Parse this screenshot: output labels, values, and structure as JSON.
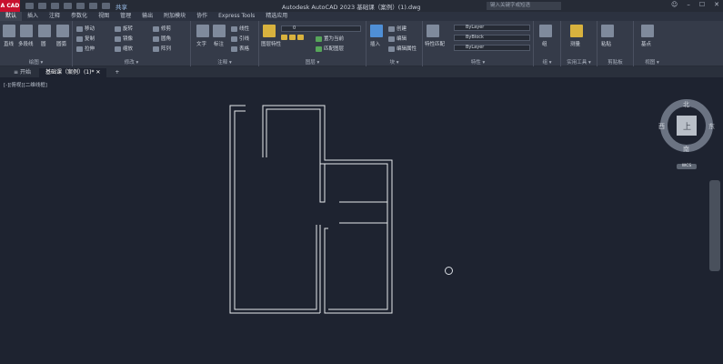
{
  "app": {
    "logo": "A CAD",
    "share": "共享",
    "title": "Autodesk AutoCAD 2023   基础课（案例）(1).dwg",
    "search_placeholder": "键入关键字或短语"
  },
  "ribbon_tabs": [
    "默认",
    "插入",
    "注释",
    "参数化",
    "视图",
    "管理",
    "输出",
    "附加模块",
    "协作",
    "Express Tools",
    "精选应用"
  ],
  "ribbon": {
    "draw": {
      "title": "绘图 ▾",
      "line": "直线",
      "polyline": "多段线",
      "circle": "圆",
      "arc": "圆弧"
    },
    "modify": {
      "title": "修改 ▾",
      "move": "移动",
      "rotate": "旋转",
      "trim": "修剪",
      "copy": "复制",
      "mirror": "镜像",
      "fillet": "圆角",
      "stretch": "拉伸",
      "scale": "缩放",
      "array": "阵列"
    },
    "annotation": {
      "title": "注释 ▾",
      "text": "文字",
      "dimension": "标注",
      "linear": "线性",
      "leader": "引线",
      "table": "表格"
    },
    "layers": {
      "title": "图层 ▾",
      "properties": "图层特性",
      "current_layer": "0",
      "make_current": "置为当前",
      "match": "匹配图层"
    },
    "block": {
      "title": "块 ▾",
      "insert": "插入",
      "create": "创建",
      "edit": "编辑",
      "edit_attr": "编辑属性"
    },
    "properties": {
      "title": "特性 ▾",
      "match": "特性匹配",
      "color": "ByLayer",
      "linetype": "ByBlock",
      "lineweight": "ByLayer"
    },
    "groups": {
      "title": "组 ▾",
      "group": "组"
    },
    "utilities": {
      "title": "实用工具 ▾",
      "measure": "测量"
    },
    "clipboard": {
      "title": "剪贴板",
      "paste": "粘贴"
    },
    "view": {
      "title": "视图 ▾",
      "base": "基点"
    }
  },
  "doc_tabs": {
    "start": "开始",
    "file": "基础课（案例）(1)*",
    "add": "+"
  },
  "viewport_label": "[-][俯视][二维线框]",
  "viewcube": {
    "north": "北",
    "south": "南",
    "east": "东",
    "west": "西",
    "top": "上",
    "wcs": "WCS"
  },
  "colors": {
    "background": "#1e2330",
    "ribbon": "#353b49",
    "lines": "#e6e8ec",
    "accent": "#c8102e"
  }
}
